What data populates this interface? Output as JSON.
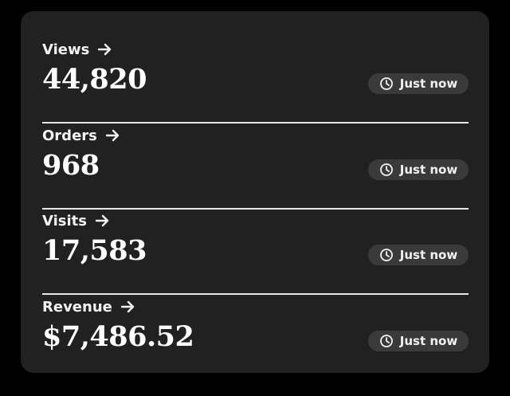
{
  "metrics": [
    {
      "label": "Views",
      "value": "44,820",
      "updated": "Just now"
    },
    {
      "label": "Orders",
      "value": "968",
      "updated": "Just now"
    },
    {
      "label": "Visits",
      "value": "17,583",
      "updated": "Just now"
    },
    {
      "label": "Revenue",
      "value": "$7,486.52",
      "updated": "Just now"
    }
  ],
  "icons": {
    "link": "arrow-right-icon",
    "time": "clock-icon"
  },
  "colors": {
    "background": "#000000",
    "card": "#212121",
    "badge": "#3a3a3a",
    "text": "#ffffff",
    "divider": "#e8e8e8"
  }
}
